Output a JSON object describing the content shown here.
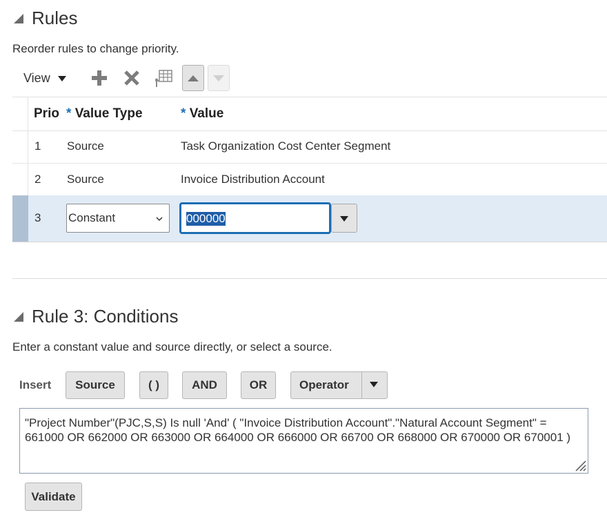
{
  "rules": {
    "title": "Rules",
    "description": "Reorder rules to change priority.",
    "toolbar": {
      "view_label": "View",
      "add_icon": "plus-icon",
      "delete_icon": "x-icon",
      "detach_icon": "table-icon",
      "move_up_icon": "arrow-up-icon",
      "move_down_icon": "arrow-down-icon"
    },
    "columns": {
      "priority": "Prio",
      "value_type": "Value Type",
      "value": "Value",
      "required_marker": "*"
    },
    "rows": [
      {
        "priority": "1",
        "value_type": "Source",
        "value": "Task Organization Cost Center Segment"
      },
      {
        "priority": "2",
        "value_type": "Source",
        "value": "Invoice Distribution Account"
      },
      {
        "priority": "3",
        "value_type": "Constant",
        "value": "000000"
      }
    ]
  },
  "conditions": {
    "title": "Rule 3: Conditions",
    "description": "Enter a constant value and source directly, or select a source.",
    "insert_label": "Insert",
    "buttons": {
      "source": "Source",
      "parens": "( )",
      "and": "AND",
      "or": "OR",
      "operator": "Operator"
    },
    "expression": " \"Project Number\"(PJC,S,S) Is null 'And' ( \"Invoice Distribution Account\".\"Natural Account Segment\" = 661000 OR 662000 OR 663000 OR 664000 OR 666000 OR 66700 OR 668000 OR 670000 OR 670001 )",
    "validate_label": "Validate"
  },
  "colors": {
    "selected_row": "#e0ebf6",
    "row_indicator": "#aec0d3",
    "focus_border": "#1d6eb5",
    "required": "#1c6fb7"
  }
}
